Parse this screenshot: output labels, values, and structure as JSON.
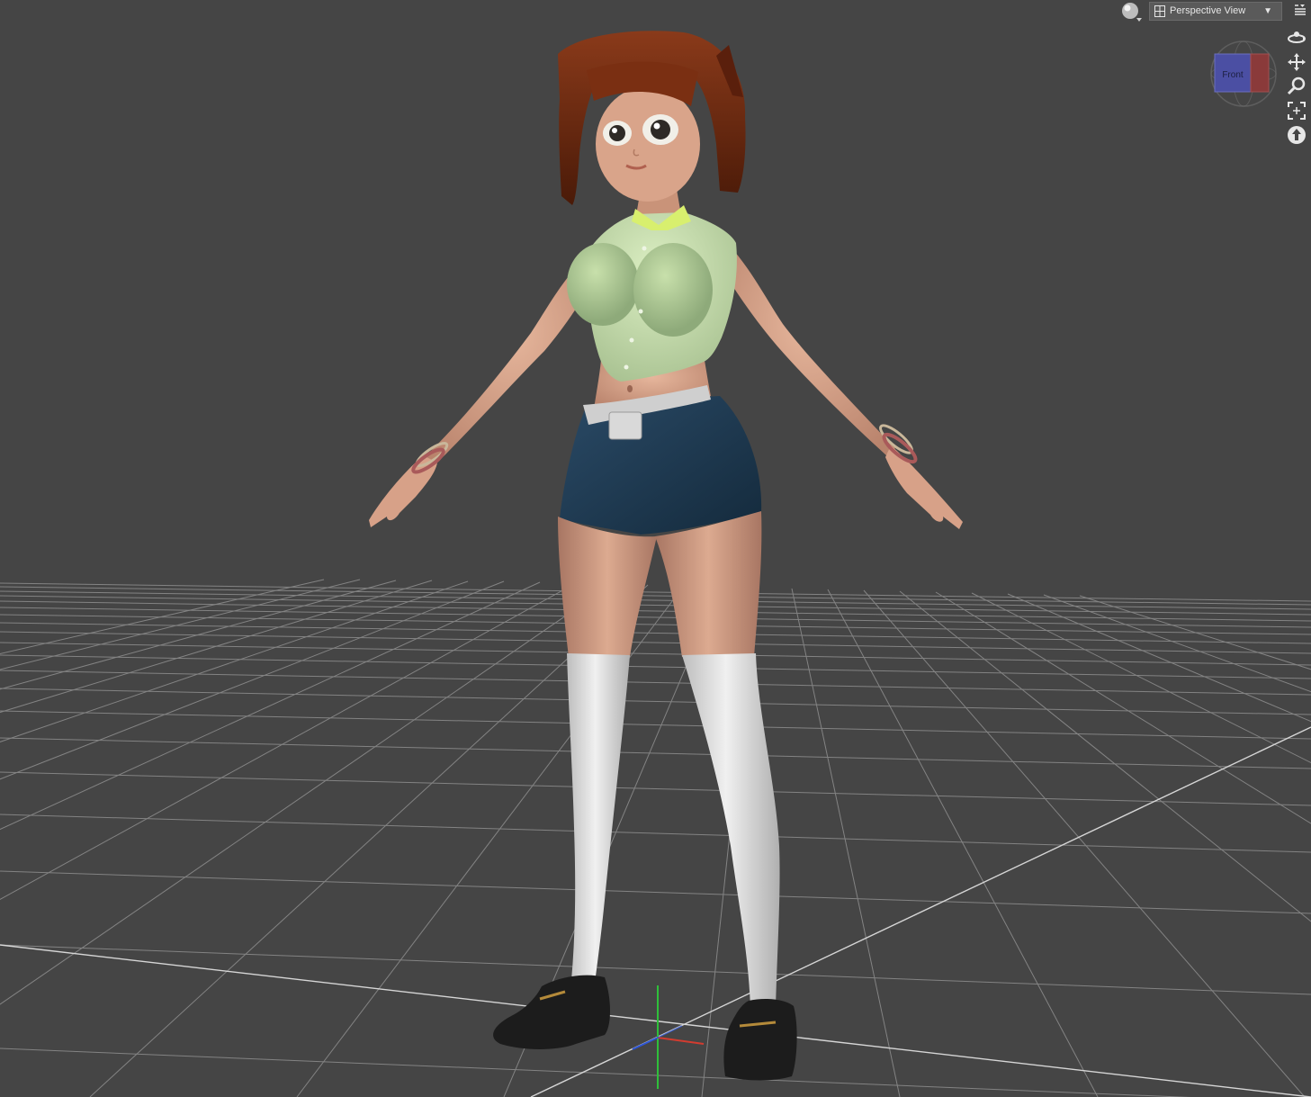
{
  "viewport": {
    "background": "#454545",
    "view_label": "Perspective View",
    "cube_face_label": "Front"
  },
  "toolbar": {
    "shading_icon": "sphere-shading-icon",
    "view_icon": "perspective-camera-icon",
    "dropdown_icon": "chevron-down-icon",
    "menu_icon": "viewport-menu-icon"
  },
  "nav_tools": [
    {
      "name": "orbit-icon"
    },
    {
      "name": "pan-icon"
    },
    {
      "name": "zoom-icon"
    },
    {
      "name": "frame-icon"
    },
    {
      "name": "reset-view-icon"
    }
  ],
  "colors": {
    "grid_line": "#9a9a9a",
    "grid_main": "#d9d9d9",
    "axis_x": "#c0392b",
    "axis_y": "#27ae60",
    "axis_z": "#2d55d6",
    "skin": "#d9a48a",
    "shirt": "#cfe3b4",
    "shorts": "#1e3a52",
    "hair": "#6b2a12",
    "socks": "#e8e8e8",
    "shoes": "#1a1a1a"
  }
}
